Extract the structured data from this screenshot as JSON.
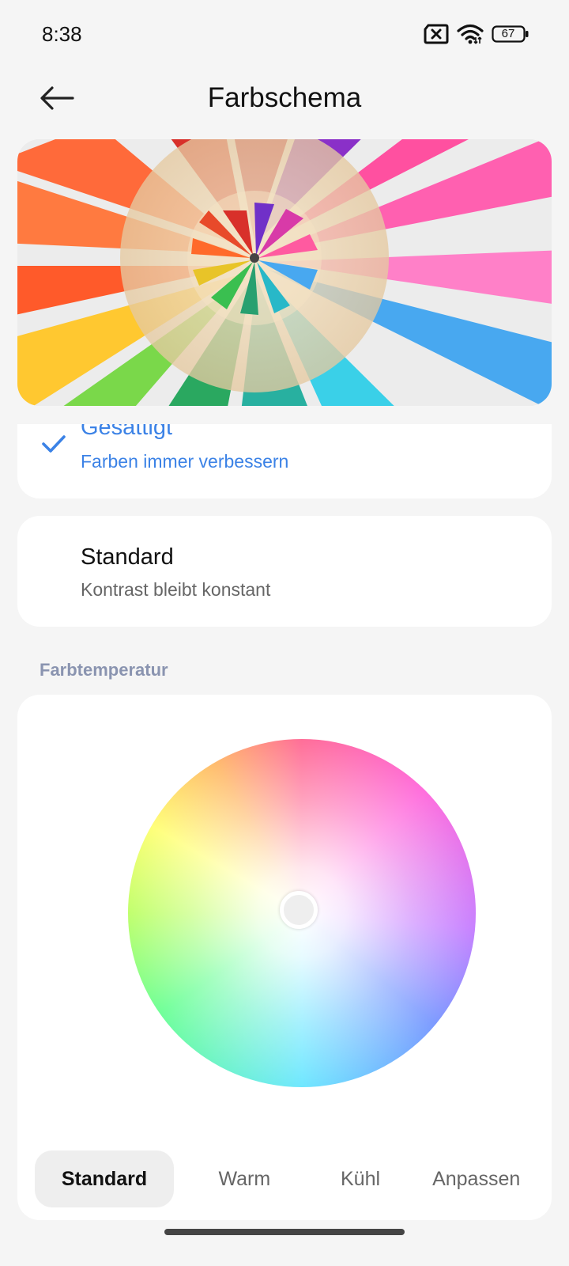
{
  "status_bar": {
    "time": "8:38",
    "battery": "67",
    "icons": [
      "sim-blocked-icon",
      "wifi-icon",
      "battery-icon"
    ]
  },
  "header": {
    "title": "Farbschema",
    "back_icon": "arrow-left-icon"
  },
  "options": [
    {
      "title": "Gesättigt",
      "subtitle": "Farben immer verbessern",
      "selected": true
    },
    {
      "title": "Standard",
      "subtitle": "Kontrast bleibt konstant",
      "selected": false
    }
  ],
  "temperature": {
    "section_label": "Farbtemperatur",
    "presets": [
      {
        "label": "Standard",
        "selected": true
      },
      {
        "label": "Warm",
        "selected": false
      },
      {
        "label": "Kühl",
        "selected": false
      },
      {
        "label": "Anpassen",
        "selected": false
      }
    ]
  },
  "colors": {
    "accent": "#3b82e6",
    "background": "#f5f5f5",
    "card": "#ffffff",
    "section_label": "#8a94b0"
  }
}
